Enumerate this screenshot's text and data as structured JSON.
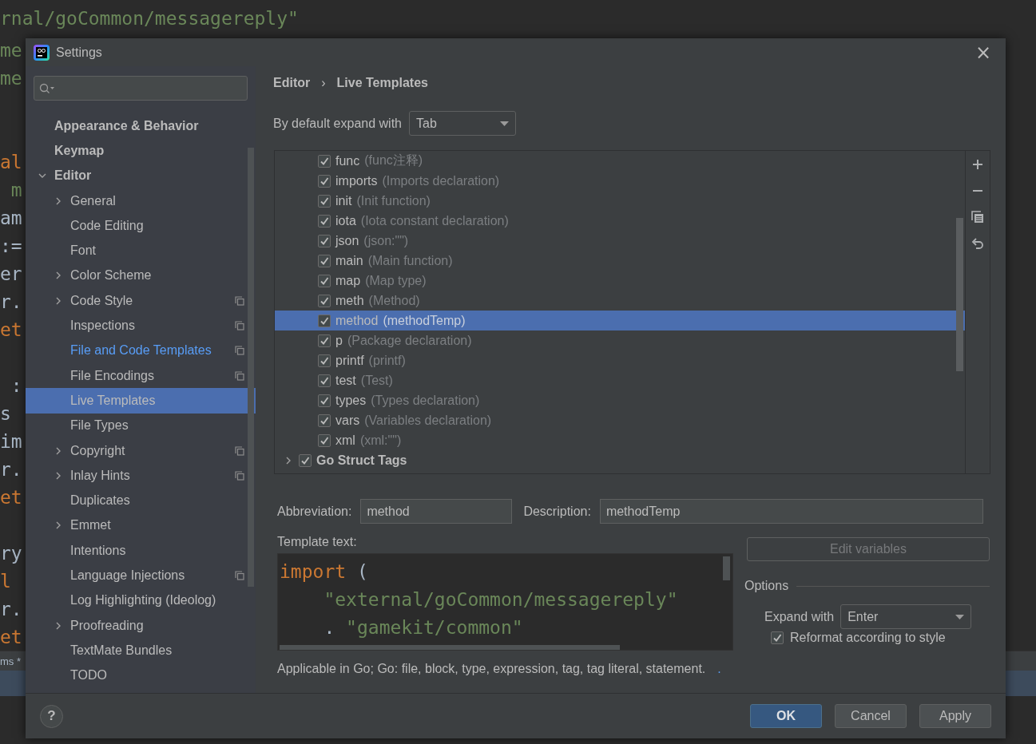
{
  "editor_lines": [
    {
      "text": "rnal/goCommon/messagereply\"",
      "kind": "string"
    },
    {
      "text": "me",
      "kind": "string"
    },
    {
      "text": "me",
      "kind": "string"
    },
    {
      "kind": "blank"
    },
    {
      "kind": "blank"
    },
    {
      "text": "al",
      "kind": "keyword"
    },
    {
      "text": " m",
      "kind": "string"
    },
    {
      "text": "am",
      "kind": "plain"
    },
    {
      "text": ":=",
      "kind": "plain"
    },
    {
      "text": "er",
      "kind": "plain"
    },
    {
      "text": "r.",
      "kind": "plain"
    },
    {
      "text": "et",
      "kind": "keyword"
    },
    {
      "kind": "blank"
    },
    {
      "text": " :",
      "kind": "plain"
    },
    {
      "text": "s",
      "kind": "plain"
    },
    {
      "text": "im",
      "kind": "plain"
    },
    {
      "text": "r.",
      "kind": "plain"
    },
    {
      "text": "et",
      "kind": "keyword"
    },
    {
      "kind": "blank"
    },
    {
      "text": "ry",
      "kind": "plain"
    },
    {
      "text": "l",
      "kind": "keyword"
    },
    {
      "text": "r.",
      "kind": "plain"
    },
    {
      "text": "et",
      "kind": "keyword"
    }
  ],
  "editor_tab": "ms *",
  "window": {
    "title": "Settings",
    "close": "×"
  },
  "sidebar": {
    "items": [
      {
        "kind": "leaf",
        "label": "Appearance & Behavior",
        "selected": false,
        "modified": false,
        "project_level": false
      },
      {
        "kind": "leaf",
        "label": "Keymap",
        "selected": false,
        "modified": false,
        "project_level": false
      },
      {
        "kind": "node",
        "label": "Editor",
        "expanded": true,
        "selected": false,
        "modified": false,
        "project_level": false,
        "children": [
          {
            "kind": "node",
            "label": "General",
            "expanded": false,
            "selected": false,
            "modified": false,
            "project_level": false
          },
          {
            "kind": "leaf",
            "label": "Code Editing",
            "selected": false,
            "modified": false,
            "project_level": false
          },
          {
            "kind": "leaf",
            "label": "Font",
            "selected": false,
            "modified": false,
            "project_level": false
          },
          {
            "kind": "node",
            "label": "Color Scheme",
            "expanded": false,
            "selected": false,
            "modified": false,
            "project_level": false
          },
          {
            "kind": "node",
            "label": "Code Style",
            "expanded": false,
            "selected": false,
            "modified": false,
            "project_level": true
          },
          {
            "kind": "leaf",
            "label": "Inspections",
            "selected": false,
            "modified": false,
            "project_level": true
          },
          {
            "kind": "leaf",
            "label": "File and Code Templates",
            "selected": false,
            "modified": true,
            "project_level": true
          },
          {
            "kind": "leaf",
            "label": "File Encodings",
            "selected": false,
            "modified": false,
            "project_level": true
          },
          {
            "kind": "leaf",
            "label": "Live Templates",
            "selected": true,
            "modified": false,
            "project_level": false
          },
          {
            "kind": "leaf",
            "label": "File Types",
            "selected": false,
            "modified": false,
            "project_level": false
          },
          {
            "kind": "node",
            "label": "Copyright",
            "expanded": false,
            "selected": false,
            "modified": false,
            "project_level": true
          },
          {
            "kind": "node",
            "label": "Inlay Hints",
            "expanded": false,
            "selected": false,
            "modified": false,
            "project_level": true
          },
          {
            "kind": "leaf",
            "label": "Duplicates",
            "selected": false,
            "modified": false,
            "project_level": false
          },
          {
            "kind": "node",
            "label": "Emmet",
            "expanded": false,
            "selected": false,
            "modified": false,
            "project_level": false
          },
          {
            "kind": "leaf",
            "label": "Intentions",
            "selected": false,
            "modified": false,
            "project_level": false
          },
          {
            "kind": "leaf",
            "label": "Language Injections",
            "selected": false,
            "modified": false,
            "project_level": true
          },
          {
            "kind": "leaf",
            "label": "Log Highlighting (Ideolog)",
            "selected": false,
            "modified": false,
            "project_level": false
          },
          {
            "kind": "node",
            "label": "Proofreading",
            "expanded": false,
            "selected": false,
            "modified": false,
            "project_level": false
          },
          {
            "kind": "leaf",
            "label": "TextMate Bundles",
            "selected": false,
            "modified": false,
            "project_level": false
          },
          {
            "kind": "leaf",
            "label": "TODO",
            "selected": false,
            "modified": false,
            "project_level": false
          }
        ]
      }
    ]
  },
  "breadcrumb": [
    "Editor",
    "›",
    "Live Templates"
  ],
  "expand_default": {
    "label": "By default expand with",
    "value": "Tab"
  },
  "templates": [
    {
      "kind": "template",
      "name": "func",
      "description": "(func注释)",
      "checked": true,
      "selected": false
    },
    {
      "kind": "template",
      "name": "imports",
      "description": "(Imports declaration)",
      "checked": true,
      "selected": false
    },
    {
      "kind": "template",
      "name": "init",
      "description": "(Init function)",
      "checked": true,
      "selected": false
    },
    {
      "kind": "template",
      "name": "iota",
      "description": "(Iota constant declaration)",
      "checked": true,
      "selected": false
    },
    {
      "kind": "template",
      "name": "json",
      "description": "(json:\"\")",
      "checked": true,
      "selected": false
    },
    {
      "kind": "template",
      "name": "main",
      "description": "(Main function)",
      "checked": true,
      "selected": false
    },
    {
      "kind": "template",
      "name": "map",
      "description": "(Map type)",
      "checked": true,
      "selected": false
    },
    {
      "kind": "template",
      "name": "meth",
      "description": "(Method)",
      "checked": true,
      "selected": false
    },
    {
      "kind": "template",
      "name": "method",
      "description": "(methodTemp)",
      "checked": true,
      "selected": true
    },
    {
      "kind": "template",
      "name": "p",
      "description": "(Package declaration)",
      "checked": true,
      "selected": false
    },
    {
      "kind": "template",
      "name": "printf",
      "description": "(printf)",
      "checked": true,
      "selected": false
    },
    {
      "kind": "template",
      "name": "test",
      "description": "(Test)",
      "checked": true,
      "selected": false
    },
    {
      "kind": "template",
      "name": "types",
      "description": "(Types declaration)",
      "checked": true,
      "selected": false
    },
    {
      "kind": "template",
      "name": "vars",
      "description": "(Variables declaration)",
      "checked": true,
      "selected": false
    },
    {
      "kind": "template",
      "name": "xml",
      "description": "(xml:\"\")",
      "checked": true,
      "selected": false
    },
    {
      "kind": "group",
      "name": "Go Struct Tags",
      "checked": true,
      "expanded": false,
      "selected": false
    }
  ],
  "abbreviation": {
    "label": "Abbreviation:",
    "value": "method"
  },
  "description": {
    "label": "Description:",
    "value": "methodTemp"
  },
  "template_text": {
    "label": "Template text:",
    "lines": [
      [
        {
          "text": "import",
          "kind": "keyword"
        },
        {
          "text": " (",
          "kind": "plain"
        }
      ],
      [
        {
          "text": "    \"external/goCommon/messagereply\"",
          "kind": "string"
        }
      ],
      [
        {
          "text": "    .",
          "kind": "plain"
        },
        {
          "text": " \"gamekit/common\"",
          "kind": "string"
        }
      ]
    ]
  },
  "edit_variables": {
    "label": "Edit variables",
    "disabled": true
  },
  "options": {
    "title": "Options",
    "expand_label": "Expand with",
    "expand_value": "Enter",
    "reformat": {
      "label": "Reformat according to style",
      "checked": true
    }
  },
  "applicable": {
    "text": "Applicable in Go; Go: file, block, type, expression, tag, tag literal, statement.",
    "link": "."
  },
  "help": "?",
  "buttons": [
    {
      "label": "OK",
      "primary": true
    },
    {
      "label": "Cancel",
      "primary": false
    },
    {
      "label": "Apply",
      "primary": false
    }
  ]
}
